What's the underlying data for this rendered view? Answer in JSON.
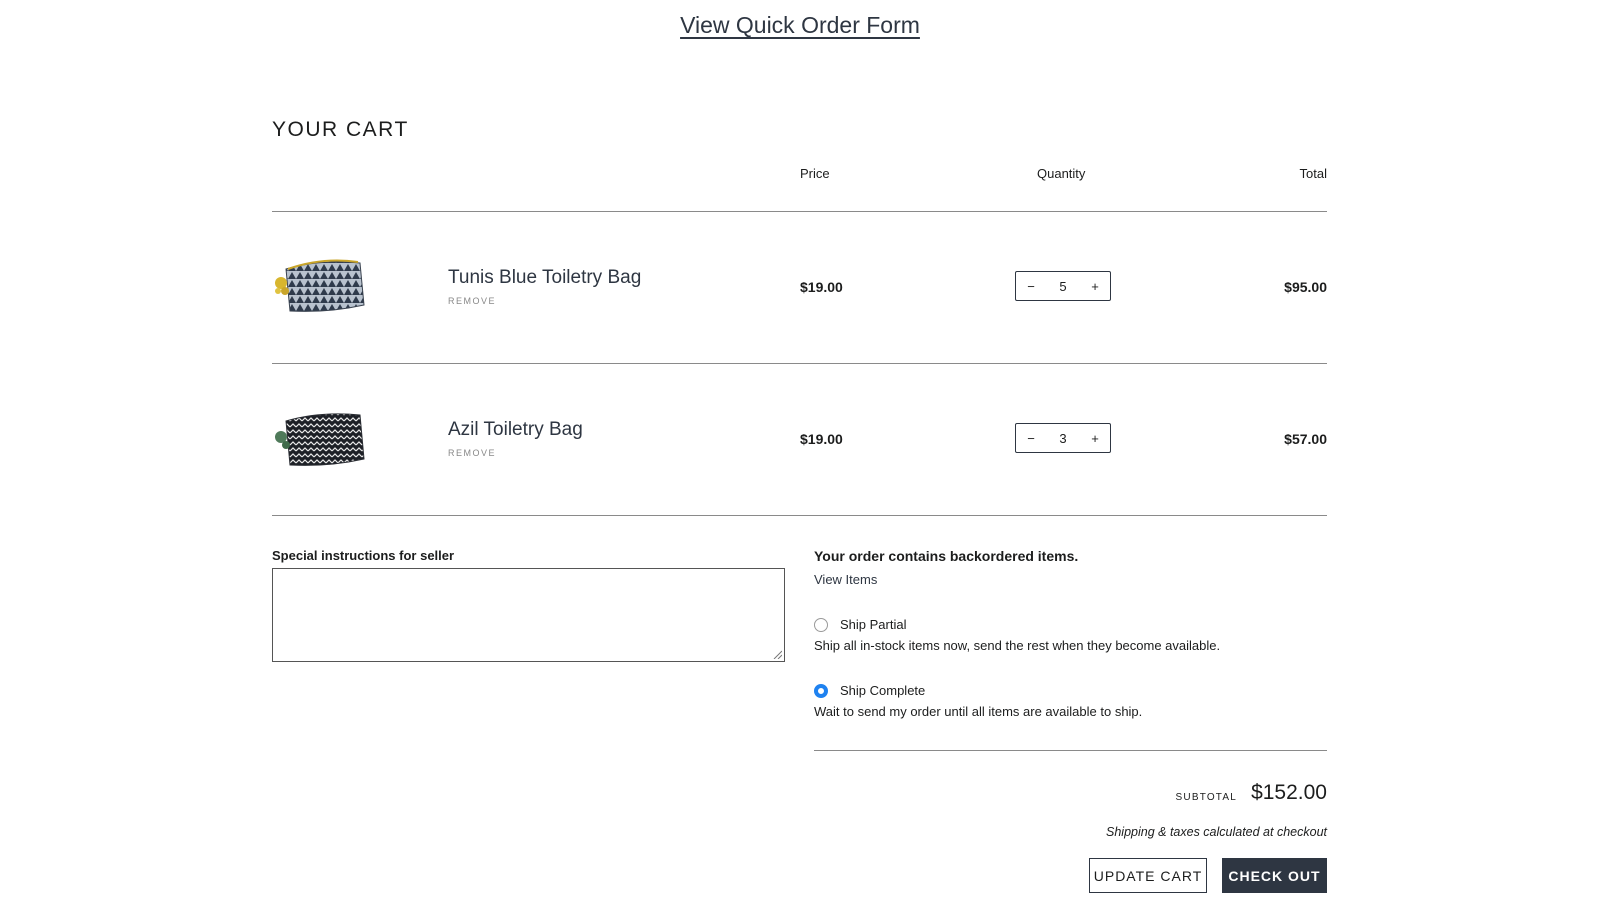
{
  "header": {
    "quick_order_link": "View Quick Order Form"
  },
  "cart": {
    "title": "YOUR CART",
    "columns": {
      "price": "Price",
      "quantity": "Quantity",
      "total": "Total"
    },
    "items": [
      {
        "name": "Tunis Blue Toiletry Bag",
        "remove_label": "REMOVE",
        "price": "$19.00",
        "qty_minus": "−",
        "quantity": "5",
        "qty_plus": "+",
        "total": "$95.00"
      },
      {
        "name": "Azil Toiletry Bag",
        "remove_label": "REMOVE",
        "price": "$19.00",
        "qty_minus": "−",
        "quantity": "3",
        "qty_plus": "+",
        "total": "$57.00"
      }
    ]
  },
  "notes": {
    "label": "Special instructions for seller",
    "value": ""
  },
  "backorder": {
    "title": "Your order contains backordered items.",
    "view_link": "View Items",
    "options": [
      {
        "label": "Ship Partial",
        "description": "Ship all in-stock items now, send the rest when they become available.",
        "selected": false
      },
      {
        "label": "Ship Complete",
        "description": "Wait to send my order until all items are available to ship.",
        "selected": true
      }
    ]
  },
  "summary": {
    "subtotal_label": "SUBTOTAL",
    "subtotal_value": "$152.00",
    "shipping_note": "Shipping & taxes calculated at checkout",
    "update_button": "UPDATE CART",
    "checkout_button": "CHECK OUT"
  },
  "colors": {
    "accent_dark": "#2e3642",
    "radio_selected": "#1f82f0"
  }
}
